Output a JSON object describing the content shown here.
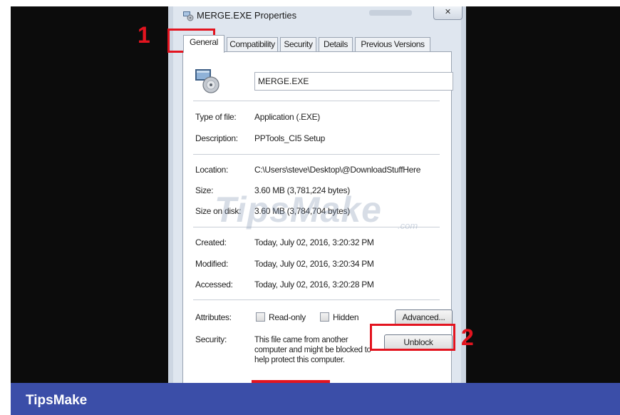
{
  "window": {
    "title": "MERGE.EXE Properties",
    "close_glyph": "✕"
  },
  "tabs": [
    {
      "label": "General",
      "active": true
    },
    {
      "label": "Compatibility",
      "active": false
    },
    {
      "label": "Security",
      "active": false
    },
    {
      "label": "Details",
      "active": false
    },
    {
      "label": "Previous Versions",
      "active": false
    }
  ],
  "file": {
    "name": "MERGE.EXE",
    "icon": "exe-disc-icon"
  },
  "properties": [
    {
      "label": "Type of file:",
      "value": "Application (.EXE)"
    },
    {
      "label": "Description:",
      "value": "PPTools_CI5 Setup"
    },
    {
      "label": "Location:",
      "value": "C:\\Users\\steve\\Desktop\\@DownloadStuffHere"
    },
    {
      "label": "Size:",
      "value": "3.60 MB (3,781,224 bytes)"
    },
    {
      "label": "Size on disk:",
      "value": "3.60 MB (3,784,704 bytes)"
    },
    {
      "label": "Created:",
      "value": "Today, July 02, 2016, 3:20:32 PM"
    },
    {
      "label": "Modified:",
      "value": "Today, July 02, 2016, 3:20:34 PM"
    },
    {
      "label": "Accessed:",
      "value": "Today, July 02, 2016, 3:20:28 PM"
    }
  ],
  "attributes": {
    "label": "Attributes:",
    "readonly_label": "Read-only",
    "readonly_checked": false,
    "hidden_label": "Hidden",
    "hidden_checked": false,
    "advanced_button": "Advanced..."
  },
  "security": {
    "label": "Security:",
    "line1": "This file came from another",
    "line2": "computer and might be blocked to",
    "line3": "help protect this computer.",
    "unblock_button": "Unblock"
  },
  "annotations": {
    "step1": "1",
    "step2": "2",
    "highlight_color": "#e3141f"
  },
  "watermark": {
    "text": "TipsMake",
    "tld": ".com"
  },
  "footer": {
    "brand": "TipsMake",
    "bar_color": "#3b4ea8"
  }
}
